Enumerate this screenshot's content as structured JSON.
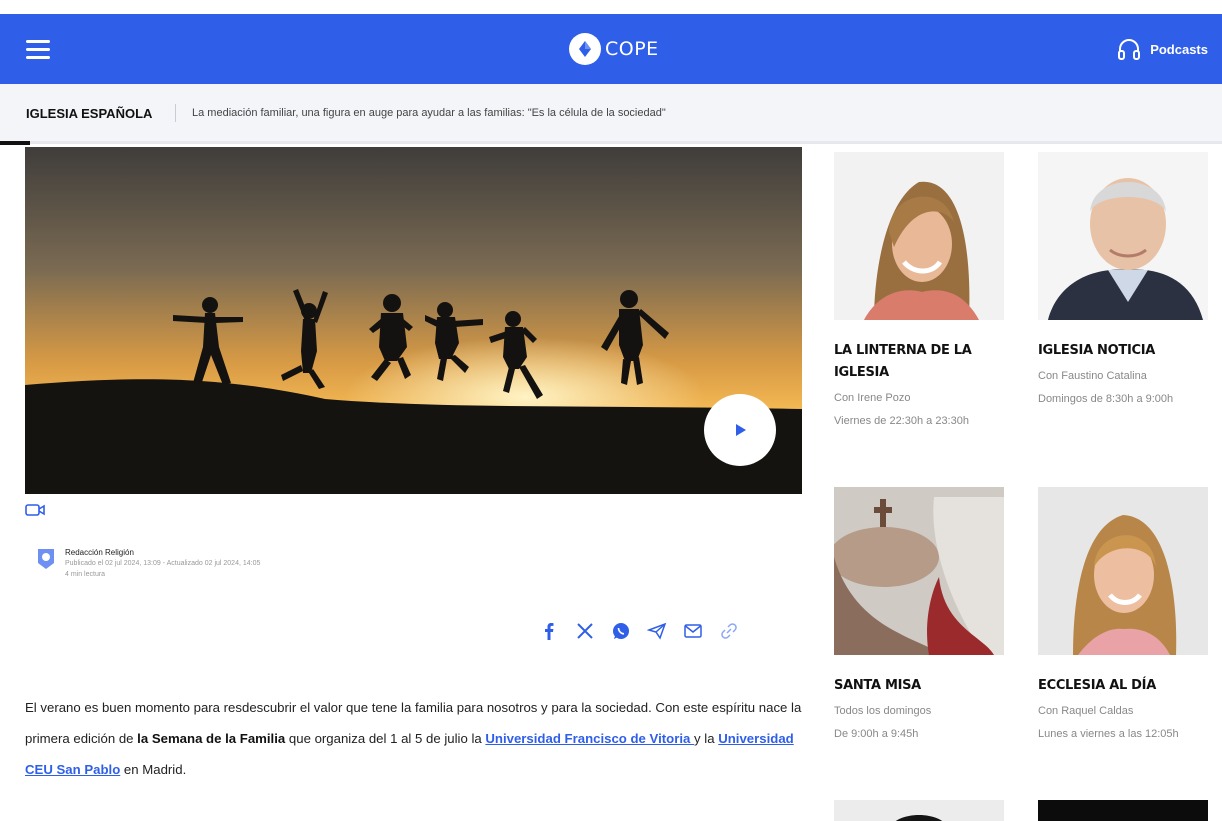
{
  "navbar": {
    "logo_text": "COPE",
    "podcasts_label": "Podcasts",
    "brand_color": "#2f5fe8"
  },
  "breadcrumb": {
    "section": "IGLESIA ESPAÑOLA",
    "headline": "La mediación familiar, una figura en auge para ayudar a las familias: \"Es la célula de la sociedad\""
  },
  "article": {
    "author": "Redacción Religión",
    "dates": "Publicado el 02 jul 2024, 13:09 - Actualizado 02 jul 2024, 14:05",
    "read_time": "4 min lectura",
    "share_icons": [
      "facebook-icon",
      "x-icon",
      "whatsapp-icon",
      "telegram-icon",
      "email-icon",
      "link-icon"
    ],
    "paragraph": {
      "p1": "El verano es buen momento para resdescubrir el valor que tene la familia para nosotros y para la sociedad. Con este espíritu nace la primera edición de ",
      "bold1": "la Semana de la Familia",
      "p2": " que organiza del 1 al 5 de julio la ",
      "link1": "Universidad Francisco de Vitoria ",
      "p3": "y la ",
      "link2": "Universidad CEU San Pablo",
      "p4": " en Madrid."
    }
  },
  "sidebar": {
    "programs": [
      {
        "title": "LA LINTERNA DE LA IGLESIA",
        "host": "Con Irene Pozo",
        "schedule": "Viernes de 22:30h a 23:30h"
      },
      {
        "title": "IGLESIA NOTICIA",
        "host": "Con Faustino Catalina",
        "schedule": "Domingos de 8:30h a 9:00h"
      },
      {
        "title": "SANTA MISA",
        "host": "Todos los domingos",
        "schedule": "De 9:00h a 9:45h"
      },
      {
        "title": "ECCLESIA AL DÍA",
        "host": "Con Raquel Caldas",
        "schedule": "Lunes a viernes a las 12:05h"
      }
    ]
  }
}
